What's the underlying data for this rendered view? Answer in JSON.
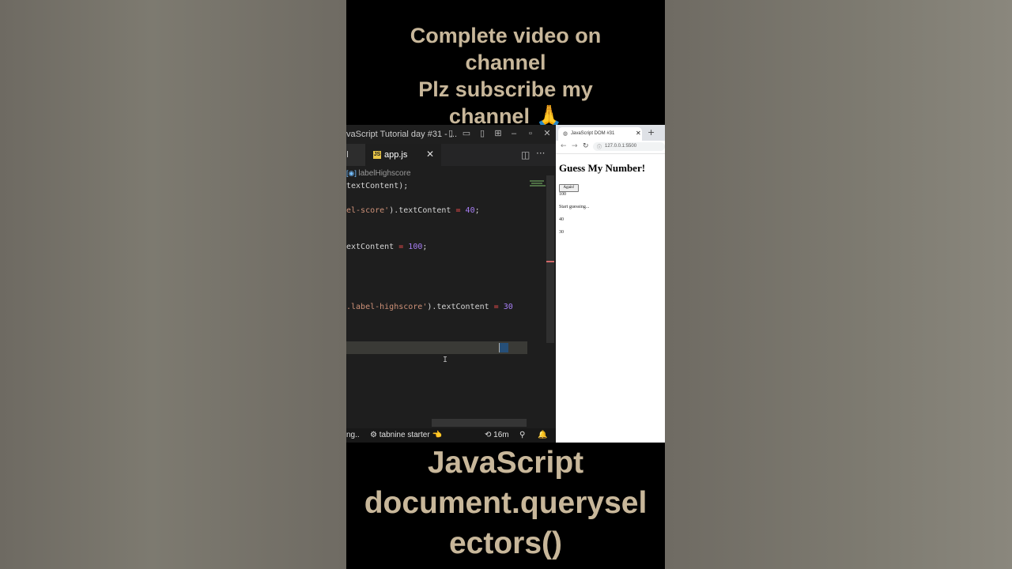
{
  "captions": {
    "top_lines": [
      "Complete video on",
      "channel",
      "Plz subscribe my",
      "channel 🙏"
    ],
    "bottom_lines": [
      "JavaScript",
      "document.querysel",
      "ectors()"
    ]
  },
  "vscode": {
    "window_title": "vaScript Tutorial day #31 - ...",
    "titlebar_icons": [
      "layout-sidebar-icon",
      "layout-panel-icon",
      "layout-sidebar-right-icon",
      "customize-layout-icon",
      "minimize-icon",
      "maximize-icon",
      "close-icon"
    ],
    "tabs": [
      {
        "label": "l"
      },
      {
        "label": "app.js",
        "icon": "js"
      }
    ],
    "code": {
      "hint": "labelHighscore",
      "lines": [
        {
          "parts": [
            {
              "t": "textContent",
              "c": ""
            },
            {
              "t": ");",
              "c": ""
            }
          ]
        },
        {
          "parts": [
            {
              "t": "el-score'",
              "c": "str"
            },
            {
              "t": ").textContent ",
              "c": ""
            },
            {
              "t": "=",
              "c": "op"
            },
            {
              "t": " ",
              "c": ""
            },
            {
              "t": "40",
              "c": "num2"
            },
            {
              "t": ";",
              "c": ""
            }
          ]
        },
        {
          "parts": [
            {
              "t": "extContent ",
              "c": ""
            },
            {
              "t": "=",
              "c": "op"
            },
            {
              "t": " ",
              "c": ""
            },
            {
              "t": "100",
              "c": "num2"
            },
            {
              "t": ";",
              "c": ""
            }
          ]
        },
        {
          "parts": [
            {
              "t": ".label-highscore'",
              "c": "str"
            },
            {
              "t": ").textContent ",
              "c": ""
            },
            {
              "t": "=",
              "c": "op"
            },
            {
              "t": " ",
              "c": ""
            },
            {
              "t": "30",
              "c": "num2"
            }
          ]
        }
      ]
    },
    "status": {
      "left": "ng..",
      "tabnine": "tabnine starter",
      "timer": "16m"
    }
  },
  "browser": {
    "tab_title": "JavaScript DOM #31",
    "url": "127.0.0.1:5500",
    "page": {
      "heading": "Guess My Number!",
      "button": "Again!",
      "score_label": "100",
      "message": "Start guessing...",
      "val1": "40",
      "val2": "30"
    }
  }
}
